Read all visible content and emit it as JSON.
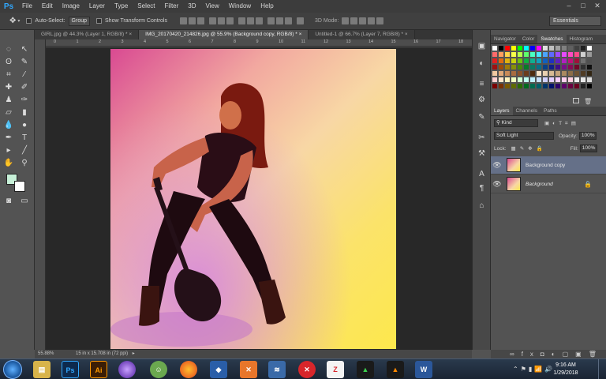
{
  "app": {
    "logo": "Ps"
  },
  "menu": [
    "File",
    "Edit",
    "Image",
    "Layer",
    "Type",
    "Select",
    "Filter",
    "3D",
    "View",
    "Window",
    "Help"
  ],
  "options_bar": {
    "auto_select_label": "Auto-Select:",
    "auto_select_value": "Group",
    "show_transform_label": "Show Transform Controls",
    "mode_label": "3D Mode:",
    "workspace": "Essentials"
  },
  "tabs": [
    {
      "label": "GIRL.jpg @ 44.3% (Layer 1, RGB/8) *",
      "active": false
    },
    {
      "label": "IMG_20170420_214826.jpg @ 55.9% (Background copy, RGB/8) *",
      "active": true
    },
    {
      "label": "Untitled-1 @ 66.7% (Layer 7, RGB/8) *",
      "active": false
    }
  ],
  "ruler_ticks": [
    "0",
    "1",
    "2",
    "3",
    "4",
    "5",
    "6",
    "7",
    "8",
    "9",
    "10",
    "11",
    "12",
    "13",
    "14",
    "15",
    "16",
    "17",
    "18"
  ],
  "status": {
    "zoom": "55.88%",
    "doc_info": "15 in x 15.708 in (72 ppi)"
  },
  "panels": {
    "top_tabs": [
      "Navigator",
      "Color",
      "Swatches",
      "Histogram"
    ],
    "top_active": "Swatches",
    "layer_tabs": [
      "Layers",
      "Channels",
      "Paths"
    ],
    "kind_label": "Kind",
    "blend_mode": "Soft Light",
    "opacity_label": "Opacity:",
    "opacity_value": "100%",
    "lock_label": "Lock:",
    "fill_label": "Fill:",
    "fill_value": "100%",
    "layers": [
      {
        "name": "Background copy",
        "selected": true
      },
      {
        "name": "Background",
        "selected": false
      }
    ]
  },
  "swatch_colors": {
    "row0": [
      "#ffffff",
      "#000000",
      "#ff0000",
      "#ffff00",
      "#00ff00",
      "#00ffff",
      "#0000ff",
      "#ff00ff",
      "#e0e0e0",
      "#c0c0c0",
      "#a0a0a0",
      "#808080",
      "#606060",
      "#404040",
      "#202020",
      "#ffffff"
    ],
    "row1": [
      "#ff6a6a",
      "#ff9e5e",
      "#ffd24a",
      "#f7ff4a",
      "#b8ff4a",
      "#5eff6a",
      "#4affc4",
      "#4ae6ff",
      "#4aa4ff",
      "#5e6aff",
      "#9e4aff",
      "#e64aff",
      "#ff4ac4",
      "#ff4a8a",
      "#d0d0d0",
      "#9a9a9a"
    ],
    "row2": [
      "#e02020",
      "#e06a10",
      "#e0b010",
      "#c8d010",
      "#70c010",
      "#10b040",
      "#10b090",
      "#10a0c0",
      "#1060c0",
      "#2030c0",
      "#6020c0",
      "#b020c0",
      "#c0107a",
      "#a0103a",
      "#707070",
      "#505050"
    ],
    "row3": [
      "#a01010",
      "#a04a08",
      "#a07a08",
      "#88900a",
      "#488808",
      "#087a28",
      "#087a64",
      "#086e88",
      "#084088",
      "#101e88",
      "#400e88",
      "#7a0e88",
      "#880a56",
      "#700828",
      "#303030",
      "#101010"
    ],
    "row4": [
      "#f0c8a0",
      "#e0a878",
      "#c88a58",
      "#a86c40",
      "#8a522c",
      "#6c3c1c",
      "#4e2a10",
      "#f4e0c8",
      "#e8d0b0",
      "#d8bc94",
      "#c4a47a",
      "#aa8a60",
      "#8c6e48",
      "#6e5434",
      "#503c24",
      "#322614"
    ],
    "row5": [
      "#ffd0d0",
      "#ffe4c8",
      "#fff4c0",
      "#f0ffc0",
      "#d0ffd0",
      "#c0fff0",
      "#c0f0ff",
      "#c8e0ff",
      "#d0d0ff",
      "#e4d0ff",
      "#f8d0ff",
      "#ffd0f0",
      "#ffd0e0",
      "#f0f0f0",
      "#e8e8e8",
      "#dcdcdc"
    ],
    "row6": [
      "#7a0000",
      "#7a3000",
      "#7a5a00",
      "#5e6a00",
      "#2a6a00",
      "#006a1e",
      "#006a50",
      "#005e6a",
      "#00346a",
      "#00106a",
      "#2e006a",
      "#5e006a",
      "#6a0040",
      "#6a0020",
      "#222222",
      "#000000"
    ]
  },
  "clock": {
    "time": "9:16 AM",
    "date": "1/29/2018"
  },
  "taskbar_apps": [
    "Ps",
    "Ai"
  ]
}
